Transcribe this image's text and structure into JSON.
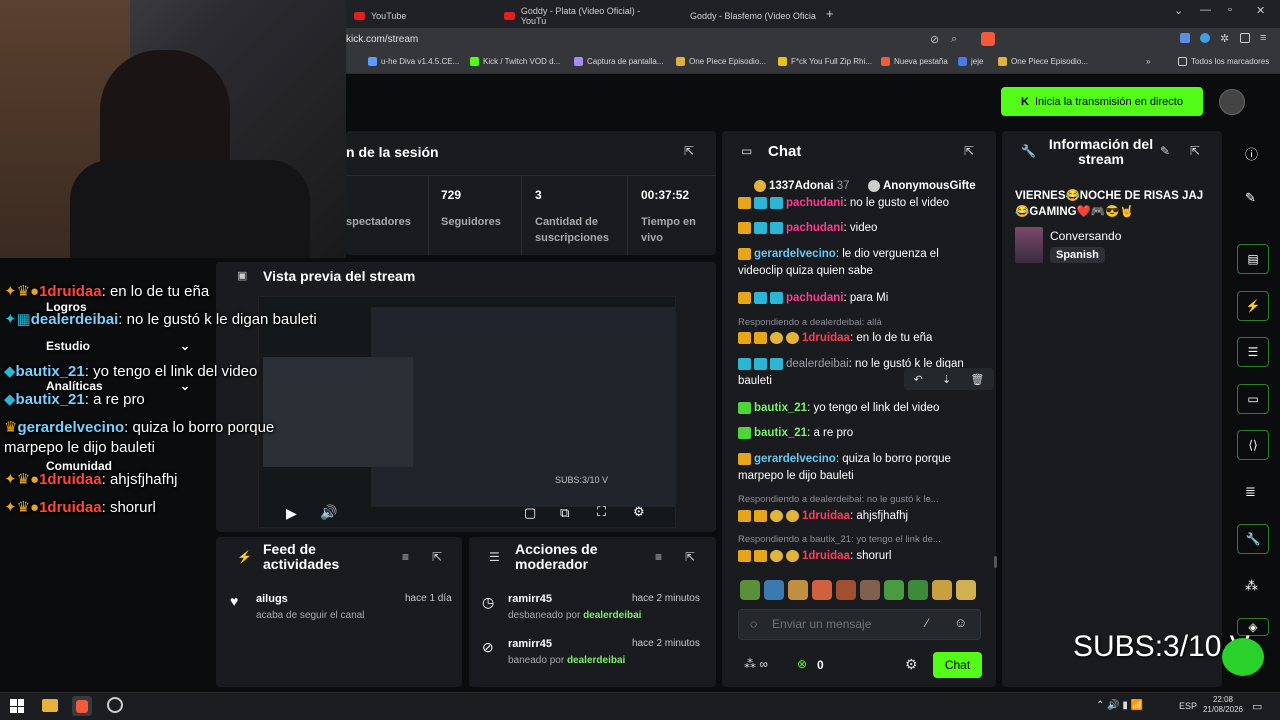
{
  "browser": {
    "tabs": [
      {
        "label": "YouTube"
      },
      {
        "label": "Goddy - Plata (Video Oficial) - YouTu"
      },
      {
        "label": "Goddy - Blasfemo (Video Oficial) - Yo"
      }
    ],
    "new_tab": "+",
    "url": "kick.com/stream",
    "bookmarks": [
      "u-he Diva v1.4.5.CE...",
      "Kick / Twitch VOD d...",
      "Captura de pantalla...",
      "One Piece Episodio...",
      "F*ck You Full Zip Rhi...",
      "Nueva pestaña",
      "jeje",
      "One Piece Episodio..."
    ],
    "bookmarks_more": "»",
    "bookmarks_folder": "Todos los marcadores"
  },
  "header": {
    "go_live_label": "Inicia la transmisión en directo"
  },
  "session": {
    "title": "n de la sesión",
    "stats": [
      {
        "value": "",
        "label": "spectadores"
      },
      {
        "value": "729",
        "label": "Seguidores"
      },
      {
        "value": "3",
        "label": "Cantidad de suscripciones"
      },
      {
        "value": "00:37:52",
        "label": "Tiempo en vivo"
      }
    ]
  },
  "preview": {
    "title": "Vista previa del stream",
    "overlay_text": "SUBS:3/10 V"
  },
  "activity_feed": {
    "title": "Feed de actividades",
    "items": [
      {
        "user": "ailugs",
        "action": "acaba de seguir el canal",
        "time": "hace 1 día"
      }
    ]
  },
  "mod_actions": {
    "title": "Acciones de moderador",
    "items": [
      {
        "user": "ramirr45",
        "action": "desbaneado por",
        "by": "dealerdeibai",
        "time": "hace 2 minutos"
      },
      {
        "user": "ramirr45",
        "action": "baneado por",
        "by": "dealerdeibai",
        "time": "hace 2 minutos"
      }
    ]
  },
  "chat": {
    "title": "Chat",
    "pinned_gifters": [
      {
        "name": "1337Adonai",
        "count": "37"
      },
      {
        "name": "AnonymousGifte",
        "count": ""
      }
    ],
    "messages": [
      {
        "user": "pachudani",
        "text": ": no le gusto el video",
        "reply": ""
      },
      {
        "user": "pachudani",
        "text": ": video",
        "reply": ""
      },
      {
        "user": "gerardelvecino",
        "text": ": le dio verguenza el videoclip quiza quien sabe",
        "reply": ""
      },
      {
        "user": "pachudani",
        "text": ": para Mi",
        "reply": ""
      },
      {
        "user": "1druidaa",
        "text": ": en lo de tu eña",
        "reply": "Respondiendo a dealerdeibai: allá"
      },
      {
        "user": "dealerdeibai",
        "text": ": no le gustó k le digan bauleti",
        "reply": ""
      },
      {
        "user": "bautix_21",
        "text": ": yo tengo el link del video",
        "reply": ""
      },
      {
        "user": "bautix_21",
        "text": ": a re pro",
        "reply": ""
      },
      {
        "user": "gerardelvecino",
        "text": ": quiza lo borro porque marpepo le dijo bauleti",
        "reply": ""
      },
      {
        "user": "1druidaa",
        "text": ": ahjsfjhafhj",
        "reply": "Respondiendo a dealerdeibai: no le gustó k le..."
      },
      {
        "user": "1druidaa",
        "text": ": shorurl",
        "reply": "Respondiendo a bautix_21: yo tengo el link de..."
      }
    ],
    "input_placeholder": "Enviar un mensaje",
    "points": "0",
    "send_label": "Chat"
  },
  "stream_info": {
    "title": "Información del stream",
    "stream_title": "VIERNES😂NOCHE DE RISAS JAJ 😂GAMING❤️🎮😎🤘",
    "category": "Conversando",
    "language": "Spanish"
  },
  "overlay_chat": {
    "lines": [
      {
        "user": "1druidaa",
        "text": ": en lo de tu eña"
      },
      {
        "user": "dealerdeibai",
        "text": ": no le gustó k le digan bauleti"
      },
      {
        "user": "bautix_21",
        "text": ": yo tengo el link del video"
      },
      {
        "user": "bautix_21",
        "text": ": a re pro"
      },
      {
        "user": "gerardelvecino",
        "text": ": quiza lo borro porque marpepo le dijo bauleti"
      },
      {
        "user": "1druidaa",
        "text": ": ahjsfjhafhj"
      },
      {
        "user": "1druidaa",
        "text": ": shorurl"
      }
    ],
    "menu": [
      "Logros",
      "Estudio",
      "Analíticas",
      "Comunidad"
    ]
  },
  "taskbar": {
    "lang": "ESP",
    "time": "22:08",
    "date": "21/08/2026"
  },
  "colors": {
    "kick_green": "#53fc18",
    "panel_bg": "#191b1f",
    "page_bg": "#0b0c0e"
  }
}
